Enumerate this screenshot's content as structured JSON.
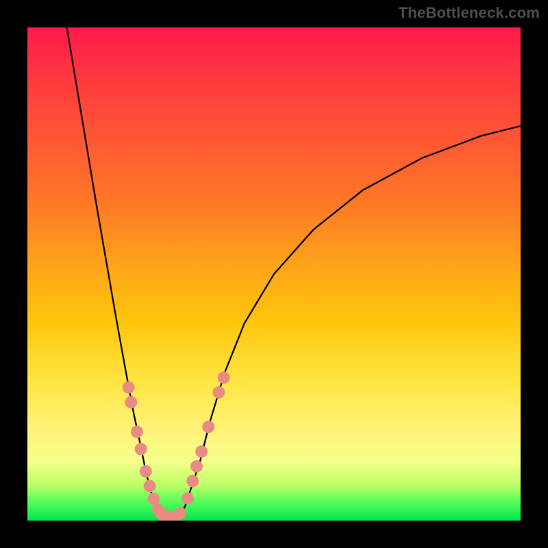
{
  "watermark": {
    "text": "TheBottleneck.com"
  },
  "chart_data": {
    "type": "line",
    "title": "",
    "xlabel": "",
    "ylabel": "",
    "xlim": [
      0,
      100
    ],
    "ylim": [
      0,
      100
    ],
    "grid": false,
    "annotations": [],
    "series": [
      {
        "name": "left-branch",
        "x": [
          8,
          10,
          12,
          14,
          16,
          18,
          20,
          21.5,
          23,
          24,
          25,
          26,
          27
        ],
        "values": [
          100,
          88,
          76,
          64,
          52.5,
          41,
          30,
          22,
          15,
          10,
          6,
          3,
          1
        ]
      },
      {
        "name": "right-branch",
        "x": [
          31,
          32,
          33,
          35,
          37,
          40,
          44,
          50,
          58,
          68,
          80,
          92,
          100
        ],
        "values": [
          1,
          3,
          6,
          12,
          20,
          30,
          40,
          50,
          59,
          67,
          73.5,
          78,
          80
        ]
      }
    ],
    "markers": [
      {
        "series": "left-branch",
        "x": 20.5,
        "y": 27
      },
      {
        "series": "left-branch",
        "x": 21.0,
        "y": 24
      },
      {
        "series": "left-branch",
        "x": 22.2,
        "y": 18
      },
      {
        "series": "left-branch",
        "x": 23.0,
        "y": 14.5
      },
      {
        "series": "left-branch",
        "x": 24.0,
        "y": 10
      },
      {
        "series": "left-branch",
        "x": 24.8,
        "y": 7
      },
      {
        "series": "left-branch",
        "x": 25.6,
        "y": 4.4
      },
      {
        "series": "left-branch",
        "x": 26.5,
        "y": 2.2
      },
      {
        "series": "left-branch",
        "x": 27.3,
        "y": 1.2
      },
      {
        "series": "left-branch",
        "x": 28.5,
        "y": 0.8
      },
      {
        "series": "right-branch",
        "x": 30.0,
        "y": 0.8
      },
      {
        "series": "right-branch",
        "x": 31.0,
        "y": 1.5
      },
      {
        "series": "right-branch",
        "x": 32.5,
        "y": 4.5
      },
      {
        "series": "right-branch",
        "x": 33.5,
        "y": 8
      },
      {
        "series": "right-branch",
        "x": 34.3,
        "y": 11
      },
      {
        "series": "right-branch",
        "x": 35.3,
        "y": 14
      },
      {
        "series": "right-branch",
        "x": 36.7,
        "y": 19
      },
      {
        "series": "right-branch",
        "x": 38.8,
        "y": 26
      },
      {
        "series": "right-branch",
        "x": 39.8,
        "y": 29
      }
    ],
    "colors": {
      "curve": "#000000",
      "markers": "#e88b83",
      "bg_gradient_top": "#ff1a4d",
      "bg_gradient_bottom": "#00e64d"
    }
  }
}
